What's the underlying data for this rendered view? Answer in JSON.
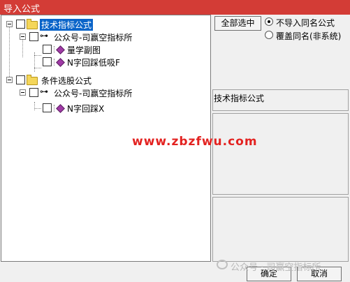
{
  "window": {
    "title": "导入公式"
  },
  "tree": {
    "nodes": [
      {
        "label": "技术指标公式"
      },
      {
        "label": "公众号-司赢空指标所"
      },
      {
        "label": "量学副图"
      },
      {
        "label": "N字回踩低吸F"
      },
      {
        "label": "条件选股公式"
      },
      {
        "label": "公众号-司赢空指标所"
      },
      {
        "label": "N字回踩X"
      }
    ]
  },
  "options": {
    "select_all": "全部选中",
    "radio_skip": "不导入同名公式",
    "radio_overwrite": "覆盖同名(非系统)"
  },
  "info": {
    "category": "技术指标公式"
  },
  "buttons": {
    "ok": "确定",
    "cancel": "取消"
  },
  "watermark": {
    "site": "www.zbzfwu.com",
    "wechat": "公众号 · 司赢空指标所"
  }
}
